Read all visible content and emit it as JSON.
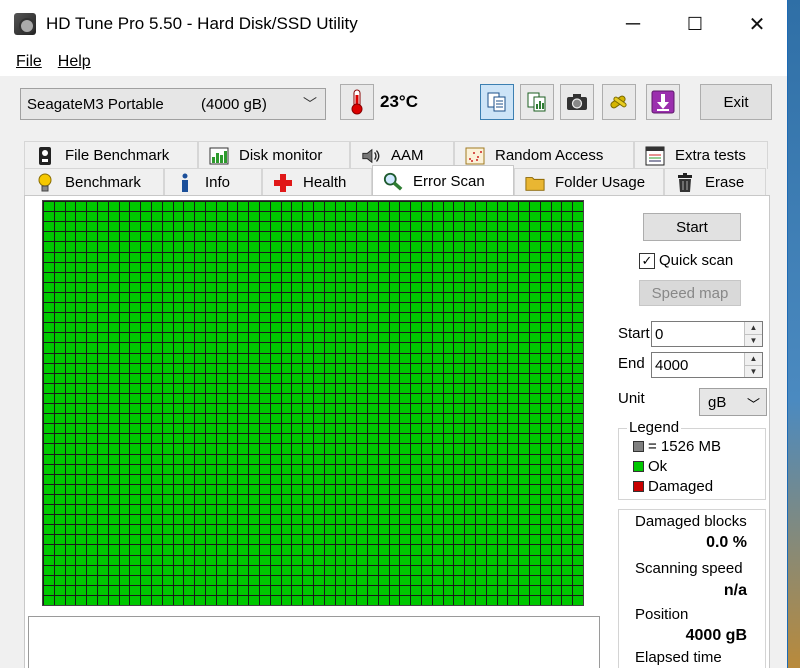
{
  "window": {
    "title": "HD Tune Pro 5.50 - Hard Disk/SSD Utility",
    "minimize": "─",
    "maximize": "☐",
    "close": "✕"
  },
  "menu": {
    "file": "File",
    "help": "Help"
  },
  "toolbar": {
    "drive_name": "SeagateM3 Portable",
    "drive_capacity": "(4000 gB)",
    "temperature": "23°C",
    "exit_label": "Exit"
  },
  "tabs": {
    "row1": [
      "File Benchmark",
      "Disk monitor",
      "AAM",
      "Random Access",
      "Extra tests"
    ],
    "row2": [
      "Benchmark",
      "Info",
      "Health",
      "Error Scan",
      "Folder Usage",
      "Erase"
    ]
  },
  "error_scan": {
    "start_button": "Start",
    "quick_scan_label": "Quick scan",
    "quick_scan_checked": true,
    "speed_map_button": "Speed map",
    "start_label": "Start",
    "start_value": "0",
    "end_label": "End",
    "end_value": "4000",
    "unit_label": "Unit",
    "unit_value": "gB",
    "legend": {
      "title": "Legend",
      "block_size": "= 1526 MB",
      "ok": "Ok",
      "damaged": "Damaged"
    },
    "stats": {
      "damaged_blocks_label": "Damaged blocks",
      "damaged_blocks_value": "0.0 %",
      "scanning_speed_label": "Scanning speed",
      "scanning_speed_value": "n/a",
      "position_label": "Position",
      "position_value": "4000 gB",
      "elapsed_time_label": "Elapsed time"
    },
    "grid": {
      "columns": 50,
      "rows": 40,
      "block_status": "ok"
    }
  },
  "colors": {
    "ok": "#00c800",
    "damaged": "#c80000",
    "block_size": "#808080",
    "grid_line": "#1a1a1a"
  }
}
